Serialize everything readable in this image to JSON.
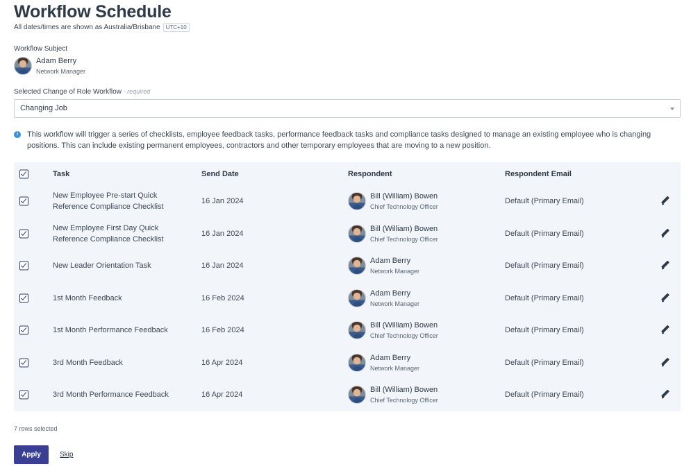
{
  "header": {
    "title": "Workflow Schedule",
    "timezone_note": "All dates/times are shown as Australia/Brisbane",
    "timezone_badge": "UTC+10"
  },
  "subject": {
    "label": "Workflow Subject",
    "name": "Adam Berry",
    "role": "Network Manager"
  },
  "workflow_select": {
    "label": "Selected Change of Role Workflow",
    "required_note": "- required",
    "value": "Changing Job"
  },
  "info": {
    "text": "This workflow will trigger a series of checklists, employee feedback tasks, performance feedback tasks and compliance tasks designed to manage an existing employee who is changing positions. This can include existing permanent employees, contractors and other temporary employees that are moving to a new position."
  },
  "table": {
    "columns": [
      "Task",
      "Send Date",
      "Respondent",
      "Respondent Email"
    ],
    "rows": [
      {
        "task": "New Employee Pre-start Quick Reference Compliance Checklist",
        "date": "16 Jan 2024",
        "respondent": "Bill (William) Bowen",
        "role": "Chief Technology Officer",
        "email": "Default (Primary Email)",
        "checked": true
      },
      {
        "task": "New Employee First Day Quick Reference Compliance Checklist",
        "date": "16 Jan 2024",
        "respondent": "Bill (William) Bowen",
        "role": "Chief Technology Officer",
        "email": "Default (Primary Email)",
        "checked": true
      },
      {
        "task": "New Leader Orientation Task",
        "date": "16 Jan 2024",
        "respondent": "Adam Berry",
        "role": "Network Manager",
        "email": "Default (Primary Email)",
        "checked": true
      },
      {
        "task": "1st Month Feedback",
        "date": "16 Feb 2024",
        "respondent": "Adam Berry",
        "role": "Network Manager",
        "email": "Default (Primary Email)",
        "checked": true
      },
      {
        "task": "1st Month Performance Feedback",
        "date": "16 Feb 2024",
        "respondent": "Bill (William) Bowen",
        "role": "Chief Technology Officer",
        "email": "Default (Primary Email)",
        "checked": true
      },
      {
        "task": "3rd Month Feedback",
        "date": "16 Apr 2024",
        "respondent": "Adam Berry",
        "role": "Network Manager",
        "email": "Default (Primary Email)",
        "checked": true
      },
      {
        "task": "3rd Month Performance Feedback",
        "date": "16 Apr 2024",
        "respondent": "Bill (William) Bowen",
        "role": "Chief Technology Officer",
        "email": "Default (Primary Email)",
        "checked": true
      }
    ]
  },
  "footer": {
    "rows_selected": "7 rows selected",
    "apply_label": "Apply",
    "skip_label": "Skip"
  },
  "colors": {
    "primary_button": "#3a3f91",
    "table_background": "#f2f5f9",
    "info_icon": "#3a8fd6"
  },
  "icons": {
    "info": "info-icon",
    "edit": "pencil-icon",
    "dropdown": "chevron-down-icon",
    "checkbox": "checkbox-checked-icon"
  }
}
